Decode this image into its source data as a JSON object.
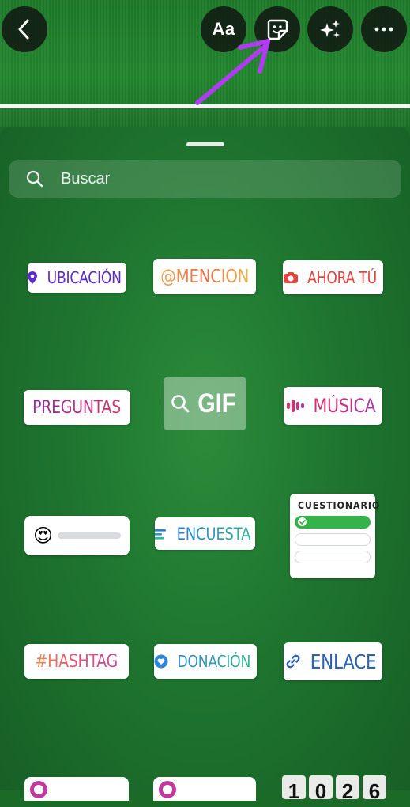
{
  "top_bar": {
    "text_button_label": "Aa",
    "icons": [
      "back-chevron-icon",
      "sticker-icon",
      "sparkles-icon",
      "more-icon"
    ],
    "annotation_arrow_color": "#b03cf0"
  },
  "sheet": {
    "search_placeholder": "Buscar"
  },
  "stickers": {
    "location": "UBICACIÓN",
    "mention": "@MENCIÓN",
    "your_turn": "AHORA TÚ",
    "questions": "PREGUNTAS",
    "gif": "GIF",
    "music": "MÚSICA",
    "slider_emoji": "😍",
    "poll": "ENCUESTA",
    "quiz_title": "CUESTIONARIO",
    "hashtag": "#HASHTAG",
    "donation": "DONACIÓN",
    "link": "ENLACE",
    "clock_digits": [
      "1",
      "0",
      "2",
      "6"
    ]
  },
  "colors": {
    "sheet_green": "#1f7630",
    "accent_purple": "#5a2ad1",
    "quiz_green": "#35b34a"
  }
}
